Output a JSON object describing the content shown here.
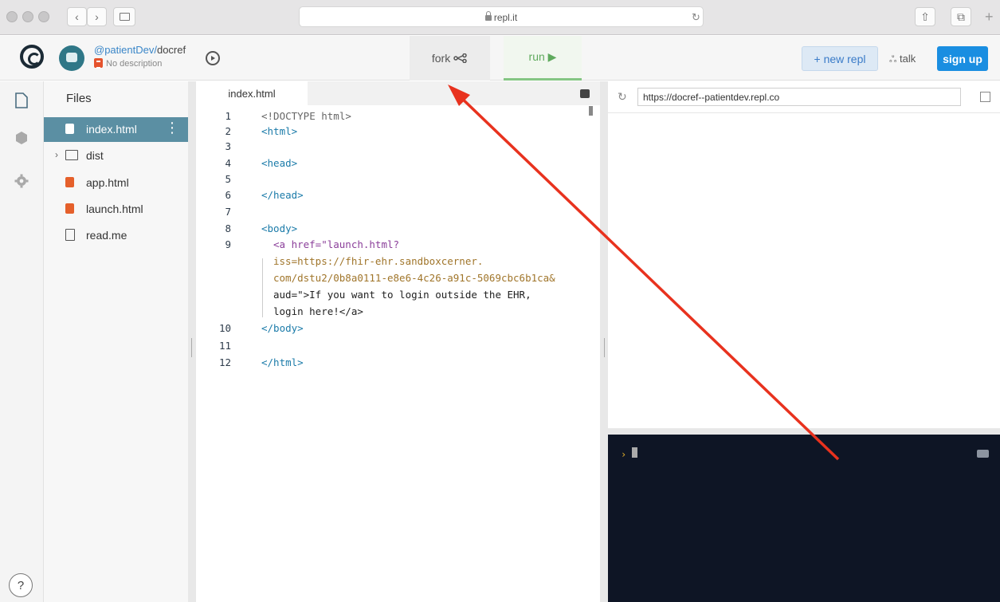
{
  "browser": {
    "url": "repl.it",
    "back_glyph": "‹",
    "forward_glyph": "›",
    "reload_glyph": "↻",
    "share_glyph": "⇧",
    "tabs_glyph": "⧉",
    "new_tab_glyph": "+"
  },
  "header": {
    "owner": "@patientDev/",
    "repl": "docref",
    "description": "No description",
    "fork_label": "fork ∝‹",
    "run_label": "run ▶",
    "new_repl_label": "+ new repl",
    "talk_label": "talk",
    "talk_glyph": "ஃ",
    "signup_label": "sign up"
  },
  "sidebar": {
    "files_title": "Files",
    "help_label": "?",
    "files": [
      {
        "name": "index.html",
        "type": "html",
        "active": true
      },
      {
        "name": "dist",
        "type": "folder"
      },
      {
        "name": "app.html",
        "type": "html"
      },
      {
        "name": "launch.html",
        "type": "html"
      },
      {
        "name": "read.me",
        "type": "doc"
      }
    ]
  },
  "editor": {
    "tab_label": "index.html",
    "lines": [
      {
        "n": "1",
        "text": "<!DOCTYPE html>"
      },
      {
        "n": "2",
        "text": "<html>"
      },
      {
        "n": "3",
        "text": ""
      },
      {
        "n": "4",
        "text": "<head>"
      },
      {
        "n": "5",
        "text": ""
      },
      {
        "n": "6",
        "text": "</head>"
      },
      {
        "n": "7",
        "text": ""
      },
      {
        "n": "8",
        "text": "<body>"
      },
      {
        "n": "9",
        "text": "<a href=\"launch.html?"
      },
      {
        "n": "",
        "text": "iss=https://fhir-ehr.sandboxcerner."
      },
      {
        "n": "",
        "text": "com/dstu2/0b8a0111-e8e6-4c26-a91c-5069cbc6b1ca&"
      },
      {
        "n": "",
        "text": "aud=\">If you want to login outside the EHR,"
      },
      {
        "n": "",
        "text": "login here!</a>"
      },
      {
        "n": "10",
        "text": "</body>"
      },
      {
        "n": "11",
        "text": ""
      },
      {
        "n": "12",
        "text": "</html>"
      }
    ]
  },
  "preview": {
    "url": "https://docref--patientdev.repl.co"
  },
  "console": {
    "prompt": "›"
  },
  "colors": {
    "accent_blue": "#1a8ee1",
    "run_green": "#84c683",
    "console_bg": "#0e1525",
    "annotation_red": "#e8321e"
  }
}
